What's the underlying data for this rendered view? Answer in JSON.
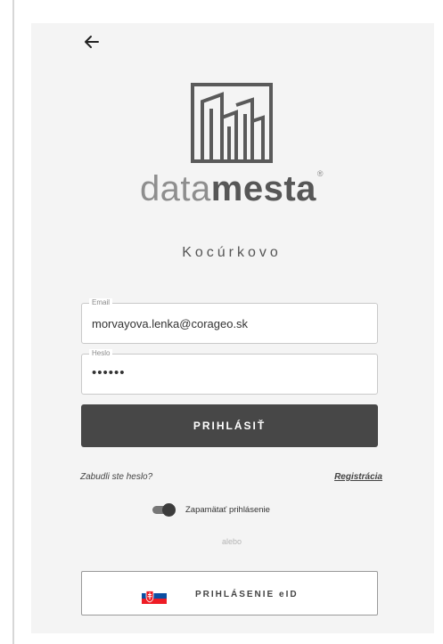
{
  "header": {
    "back_icon": "arrow-left-icon"
  },
  "brand": {
    "logo_icon": "datamesta-building-logo-icon",
    "word_thin": "data",
    "word_bold": "mesta",
    "registered": "®"
  },
  "city": {
    "name": "Kocúrkovo"
  },
  "form": {
    "email": {
      "label": "Email",
      "value": "morvayova.lenka@corageo.sk"
    },
    "password": {
      "label": "Heslo",
      "value": "••••••"
    },
    "login_button": "PRIHLÁSIŤ",
    "forgot_link": "Zabudli ste heslo?",
    "register_link": "Registrácia",
    "remember": {
      "label": "Zapamätať prihlásenie",
      "checked": true
    },
    "or_text": "alebo",
    "eid_button": {
      "label": "PRIHLÁSENIE eID",
      "flag_icon": "slovak-flag-icon"
    }
  },
  "colors": {
    "panel_bg": "#f4f4f4",
    "button_dark": "#474747",
    "text": "#444444"
  }
}
